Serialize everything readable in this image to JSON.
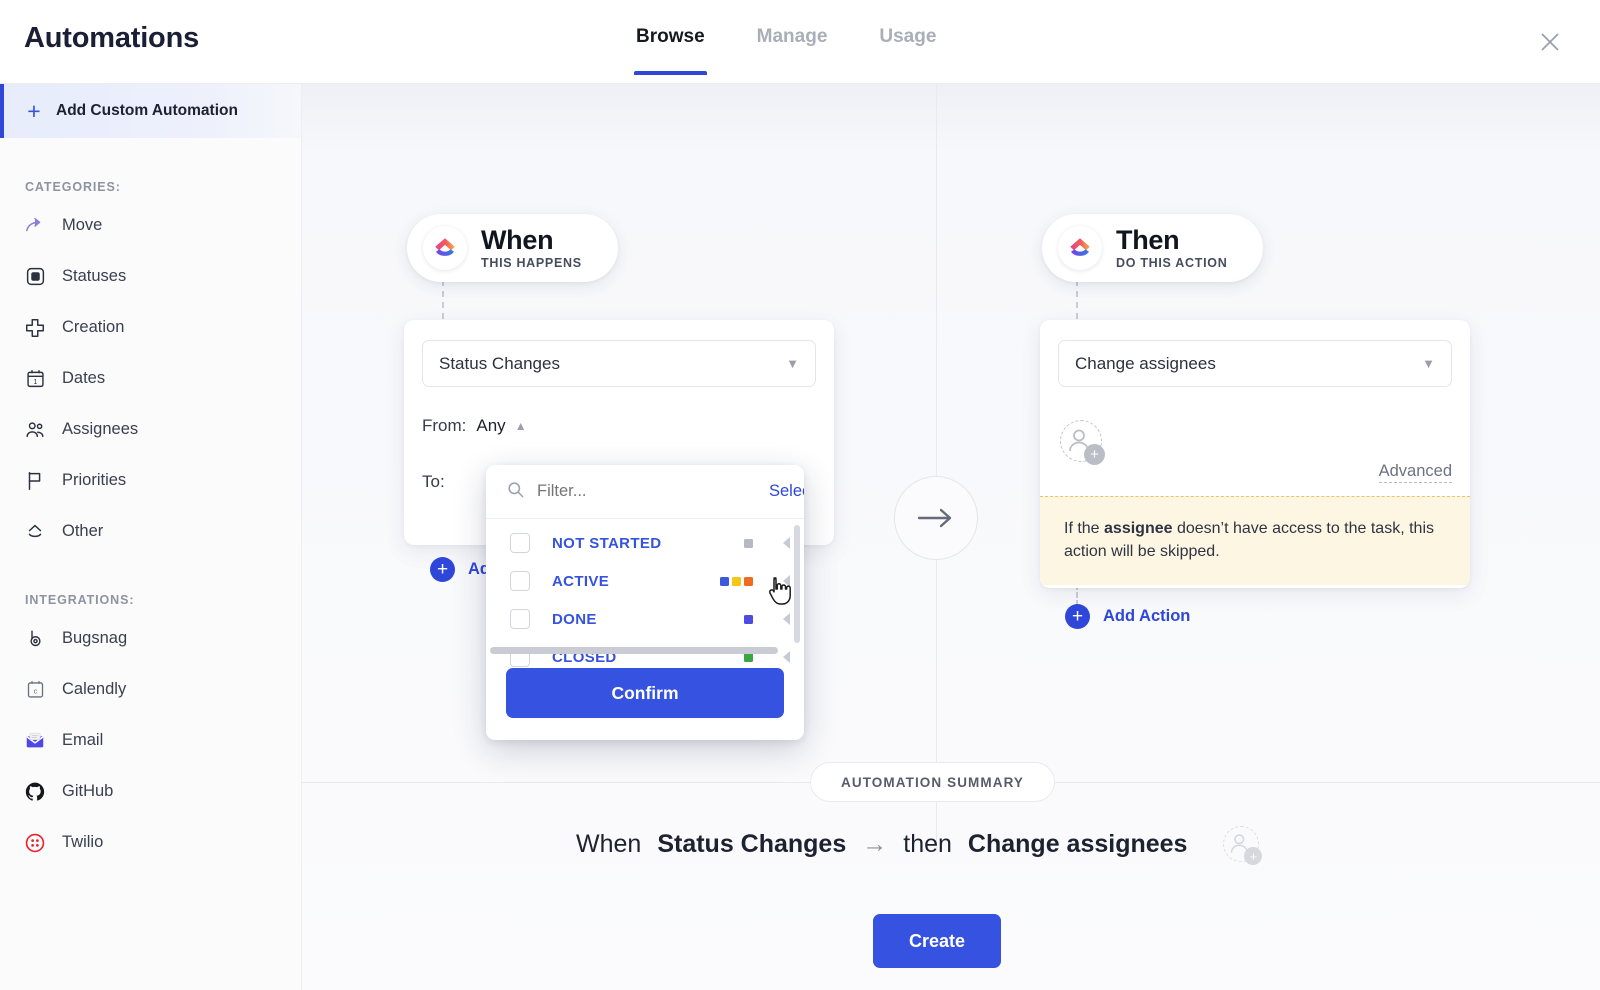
{
  "header": {
    "title": "Automations",
    "tabs": [
      {
        "label": "Browse",
        "active": true
      },
      {
        "label": "Manage",
        "active": false
      },
      {
        "label": "Usage",
        "active": false
      }
    ],
    "close_icon": "close-icon"
  },
  "sidebar": {
    "add_custom_label": "Add Custom Automation",
    "categories_label": "CATEGORIES:",
    "integrations_label": "INTEGRATIONS:",
    "categories": [
      {
        "label": "Move",
        "icon": "arrow-curve-icon"
      },
      {
        "label": "Statuses",
        "icon": "square-filled-icon"
      },
      {
        "label": "Creation",
        "icon": "plus-cross-icon"
      },
      {
        "label": "Dates",
        "icon": "calendar-icon"
      },
      {
        "label": "Assignees",
        "icon": "people-icon"
      },
      {
        "label": "Priorities",
        "icon": "flag-icon"
      },
      {
        "label": "Other",
        "icon": "clickup-outline-icon"
      }
    ],
    "integrations": [
      {
        "label": "Bugsnag",
        "icon": "bugsnag-icon"
      },
      {
        "label": "Calendly",
        "icon": "calendly-icon"
      },
      {
        "label": "Email",
        "icon": "email-icon"
      },
      {
        "label": "GitHub",
        "icon": "github-icon"
      },
      {
        "label": "Twilio",
        "icon": "twilio-icon"
      }
    ]
  },
  "trigger": {
    "pill_title": "When",
    "pill_subtitle": "THIS HAPPENS",
    "select_value": "Status Changes",
    "from_label": "From:",
    "from_value": "Any",
    "to_label": "To:",
    "add_condition_label": "Add Condition"
  },
  "status_dropdown": {
    "filter_placeholder": "Filter...",
    "select_all_label": "Select All",
    "help_icon": "question-mark-icon",
    "confirm_label": "Confirm",
    "options": [
      {
        "label": "NOT STARTED",
        "checked": false,
        "colors": [
          "#b5b9c2"
        ]
      },
      {
        "label": "ACTIVE",
        "checked": false,
        "colors": [
          "#3b5bdb",
          "#f5c518",
          "#f06a20"
        ]
      },
      {
        "label": "DONE",
        "checked": false,
        "colors": [
          "#4c4ddc"
        ]
      },
      {
        "label": "CLOSED",
        "checked": false,
        "colors": [
          "#3aa642"
        ]
      }
    ]
  },
  "action": {
    "pill_title": "Then",
    "pill_subtitle": "DO THIS ACTION",
    "select_value": "Change assignees",
    "avatar_icon": "add-assignee-icon",
    "advanced_label": "Advanced",
    "notice_prefix": "If the ",
    "notice_bold": "assignee",
    "notice_suffix": " doesn’t have access to the task, this action will be skipped.",
    "add_action_label": "Add Action"
  },
  "middle": {
    "arrow_icon": "arrow-right-icon"
  },
  "summary": {
    "chip_label": "AUTOMATION SUMMARY",
    "when_word": "When",
    "when_value": "Status Changes",
    "arrow": "→",
    "then_word": "then",
    "then_value": "Change assignees",
    "avatar_icon": "add-assignee-icon",
    "create_label": "Create"
  },
  "colors": {
    "accent": "#2f47d8",
    "accent_button": "#3552e0",
    "notice_bg": "#fdf6e3",
    "notice_border": "#e8c46a"
  }
}
